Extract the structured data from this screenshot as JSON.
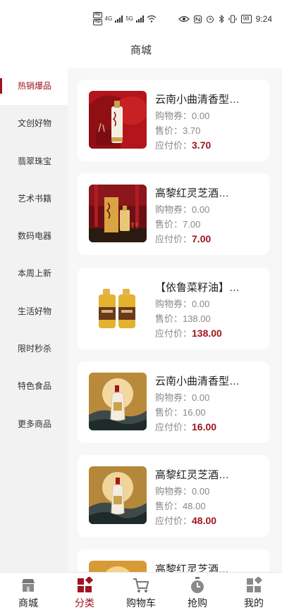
{
  "status_bar": {
    "sim1": "HD",
    "sim2": "HD",
    "net1": "4G",
    "net2": "5G",
    "battery": "98",
    "time": "9:24"
  },
  "header": {
    "title": "商城"
  },
  "sidebar": {
    "items": [
      {
        "label": "热销爆品",
        "active": true
      },
      {
        "label": "文创好物"
      },
      {
        "label": "翡翠珠宝"
      },
      {
        "label": "艺术书籍"
      },
      {
        "label": "数码电器"
      },
      {
        "label": "本周上新"
      },
      {
        "label": "生活好物"
      },
      {
        "label": "限时秒杀"
      },
      {
        "label": "特色食品"
      },
      {
        "label": "更多商品"
      }
    ]
  },
  "labels": {
    "coupon": "购物券：",
    "sale": "售价：",
    "pay": "应付价："
  },
  "products": [
    {
      "title": "云南小曲清香型…",
      "coupon": "0.00",
      "sale": "3.70",
      "pay": "3.70",
      "image": "red-baijiu-bottle"
    },
    {
      "title": "高黎红灵芝酒…",
      "coupon": "0.00",
      "sale": "7.00",
      "pay": "7.00",
      "image": "red-lingzhi-wine-box"
    },
    {
      "title": "【依鲁菜籽油】…",
      "coupon": "0.00",
      "sale": "138.00",
      "pay": "138.00",
      "image": "oil-jugs"
    },
    {
      "title": "云南小曲清香型…",
      "coupon": "0.00",
      "sale": "16.00",
      "pay": "16.00",
      "image": "gold-baijiu-bottle"
    },
    {
      "title": "高黎红灵芝酒…",
      "coupon": "0.00",
      "sale": "48.00",
      "pay": "48.00",
      "image": "gold-lingzhi-bottle"
    },
    {
      "title": "高黎红灵芝酒…",
      "coupon": "",
      "sale": "",
      "pay": "",
      "image": "gold-bottle-partial"
    }
  ],
  "tabbar": {
    "items": [
      {
        "label": "商城",
        "icon": "shop-icon"
      },
      {
        "label": "分类",
        "icon": "category-icon",
        "active": true
      },
      {
        "label": "购物车",
        "icon": "cart-icon"
      },
      {
        "label": "抢购",
        "icon": "timer-icon"
      },
      {
        "label": "我的",
        "icon": "profile-icon"
      }
    ]
  },
  "colors": {
    "accent": "#a0141e",
    "price": "#a0141e",
    "muted": "#888888"
  }
}
